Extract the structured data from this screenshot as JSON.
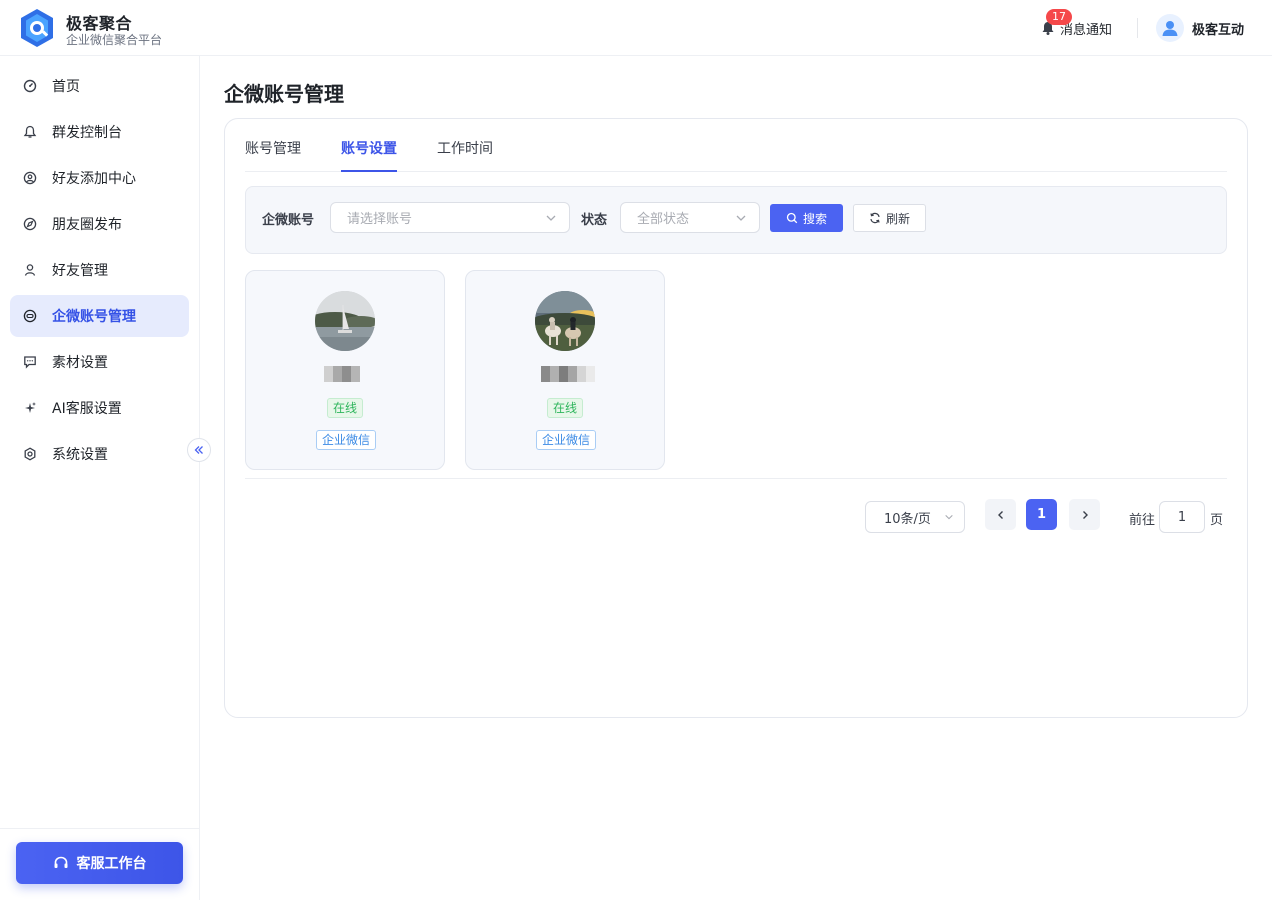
{
  "brand": {
    "title": "极客聚合",
    "subtitle": "企业微信聚合平台"
  },
  "header": {
    "notification_label": "消息通知",
    "notification_count": "17",
    "user_name": "极客互动"
  },
  "sidebar": {
    "items": [
      {
        "label": "首页",
        "icon": "dashboard-icon",
        "active": false
      },
      {
        "label": "群发控制台",
        "icon": "bell-icon",
        "active": false
      },
      {
        "label": "好友添加中心",
        "icon": "user-add-icon",
        "active": false
      },
      {
        "label": "朋友圈发布",
        "icon": "compass-icon",
        "active": false
      },
      {
        "label": "好友管理",
        "icon": "user-icon",
        "active": false
      },
      {
        "label": "企微账号管理",
        "icon": "account-icon",
        "active": true
      },
      {
        "label": "素材设置",
        "icon": "message-icon",
        "active": false
      },
      {
        "label": "AI客服设置",
        "icon": "sparkle-icon",
        "active": false
      },
      {
        "label": "系统设置",
        "icon": "gear-icon",
        "active": false
      }
    ],
    "workbench_label": "客服工作台"
  },
  "main": {
    "title": "企微账号管理",
    "tabs": [
      {
        "label": "账号管理",
        "active": false
      },
      {
        "label": "账号设置",
        "active": true
      },
      {
        "label": "工作时间",
        "active": false
      }
    ],
    "filter": {
      "account_label": "企微账号",
      "account_placeholder": "请选择账号",
      "status_label": "状态",
      "status_placeholder": "全部状态",
      "search_label": "搜索",
      "refresh_label": "刷新"
    },
    "accounts": [
      {
        "status": "在线",
        "type": "企业微信",
        "avatar": "sailboat-photo-avatar"
      },
      {
        "status": "在线",
        "type": "企业微信",
        "avatar": "horse-riders-photo-avatar"
      }
    ],
    "pagination": {
      "page_size": "10条/页",
      "current_page": "1",
      "goto_prefix": "前往",
      "goto_value": "1",
      "goto_suffix": "页"
    }
  },
  "colors": {
    "primary": "#4b63f2",
    "active_bg": "#e6ebfd",
    "success": "#2fb55c",
    "badge": "#f5484a"
  }
}
